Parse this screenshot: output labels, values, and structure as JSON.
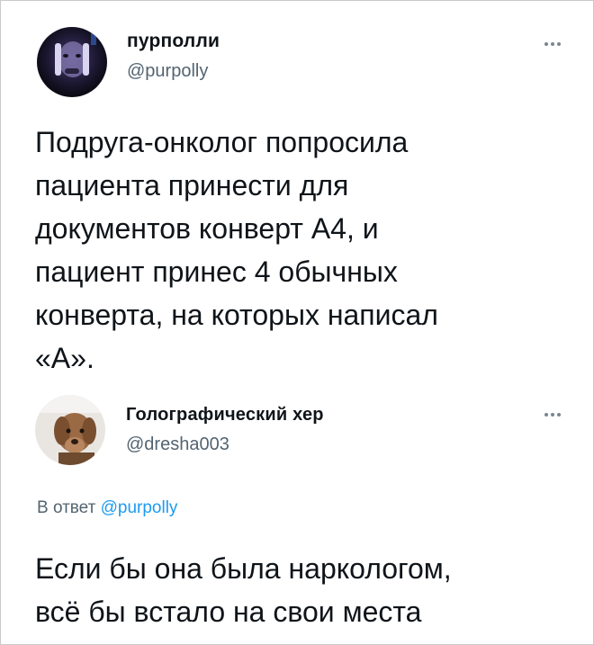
{
  "tweet": {
    "author_name": "пурполли",
    "author_handle": "@purpolly",
    "text": "Подруга-онколог попросила\nпациента принести для\nдокументов конверт А4, и\nпациент принес 4 обычных\nконверта, на которых написал\n«А»."
  },
  "reply": {
    "author_name": "Голографический хер",
    "author_handle": "@dresha003",
    "reply_prefix": "В ответ",
    "reply_handle": "@purpolly",
    "text": "Если бы она была наркологом,\nвсё бы встало на свои места"
  },
  "icons": {
    "more": "more-horizontal-icon"
  },
  "colors": {
    "text": "#0f1419",
    "secondary": "#536471",
    "link": "#1d9bf0"
  }
}
